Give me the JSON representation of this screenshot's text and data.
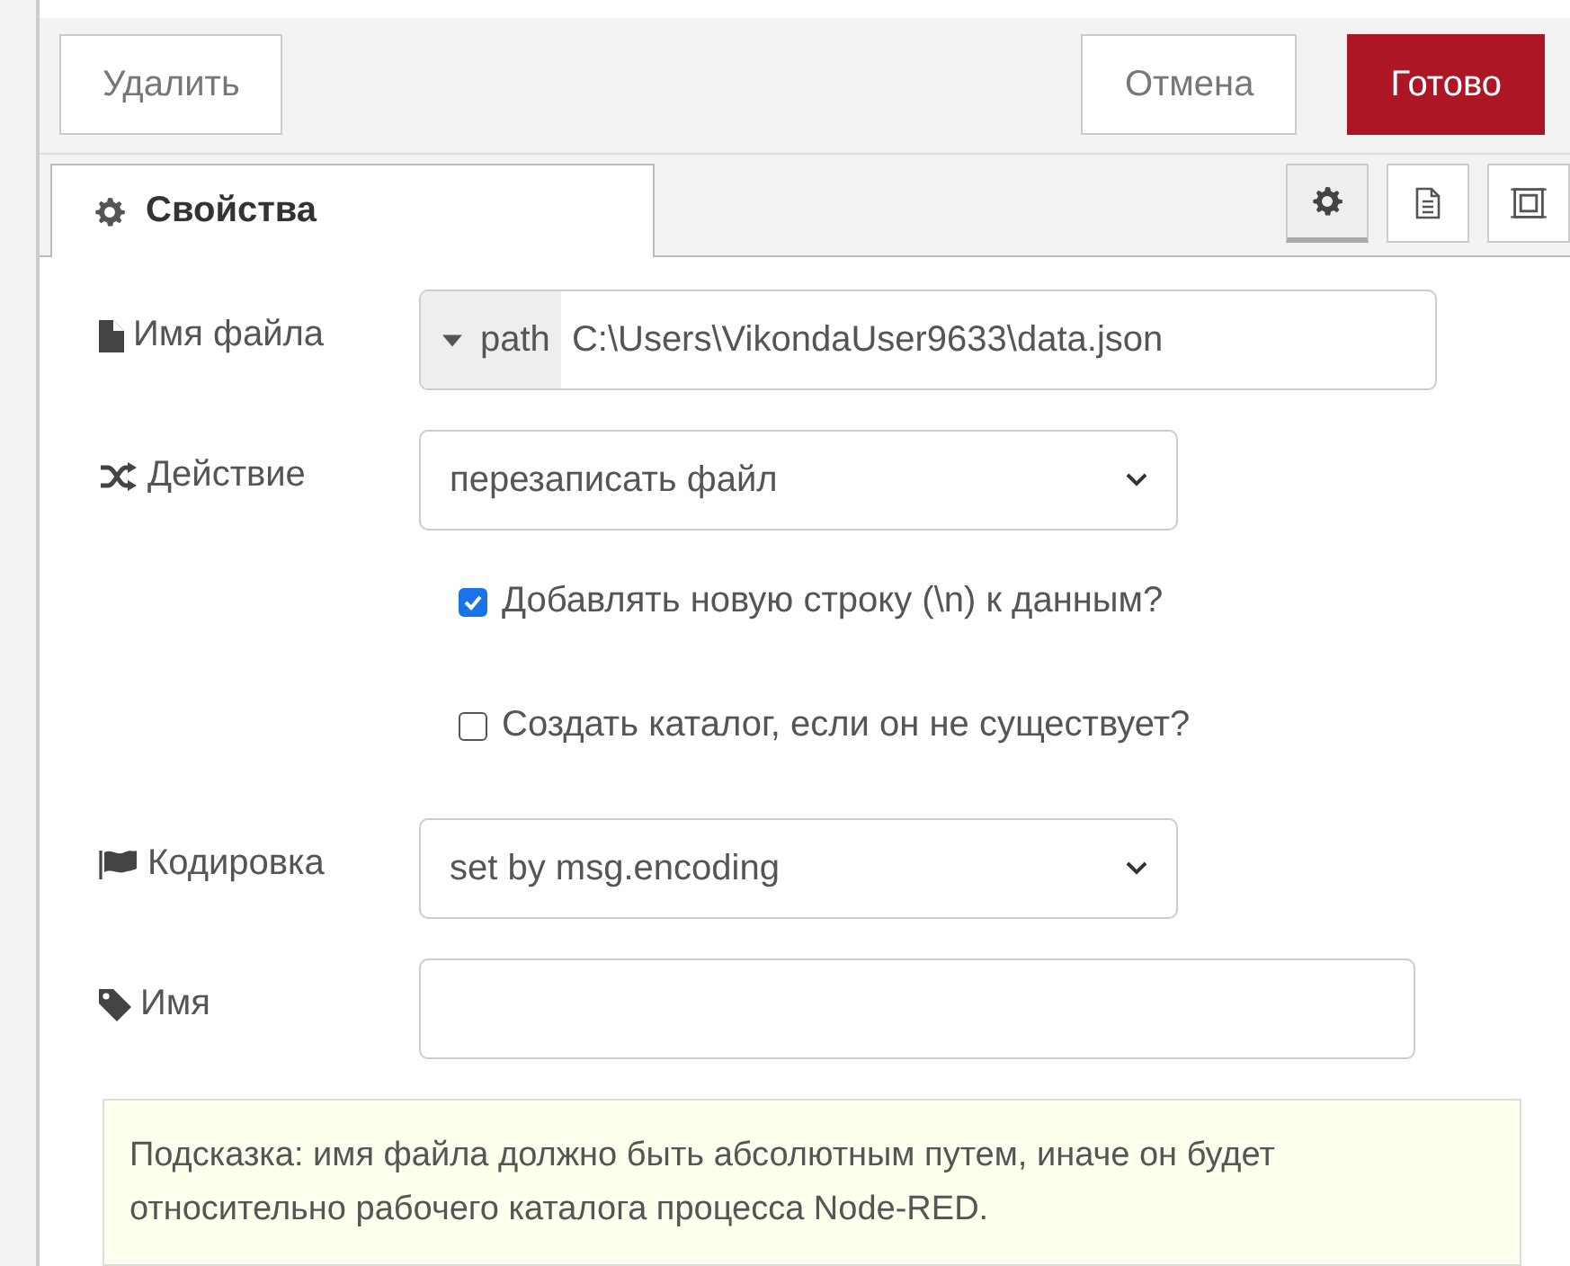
{
  "header_buttons": {
    "delete": "Удалить",
    "cancel": "Отмена",
    "done": "Готово"
  },
  "tabs": [
    {
      "label": "Свойства",
      "selected": true
    }
  ],
  "tab_tools": [
    {
      "kind": "gear",
      "selected": true
    },
    {
      "kind": "document",
      "selected": false
    },
    {
      "kind": "frame",
      "selected": false
    }
  ],
  "fields": [
    {
      "kind": "typed-input",
      "label": "Имя файла",
      "type_label": "path",
      "value": "C:\\Users\\VikondaUser9633\\data.json"
    },
    {
      "kind": "select",
      "label": "Действие",
      "value": "перезаписать файл"
    },
    {
      "kind": "checkbox",
      "label": "Добавлять новую строку (\\n) к данным?",
      "checked": true
    },
    {
      "kind": "checkbox",
      "label": "Создать каталог, если он не существует?",
      "checked": false
    },
    {
      "kind": "select",
      "label": "Кодировка",
      "value": "set by msg.encoding"
    },
    {
      "kind": "input",
      "label": "Имя"
    }
  ],
  "tip": "Подсказка: имя файла должно быть абсолютным путем, иначе он будет относительно рабочего каталога процесса Node-RED."
}
